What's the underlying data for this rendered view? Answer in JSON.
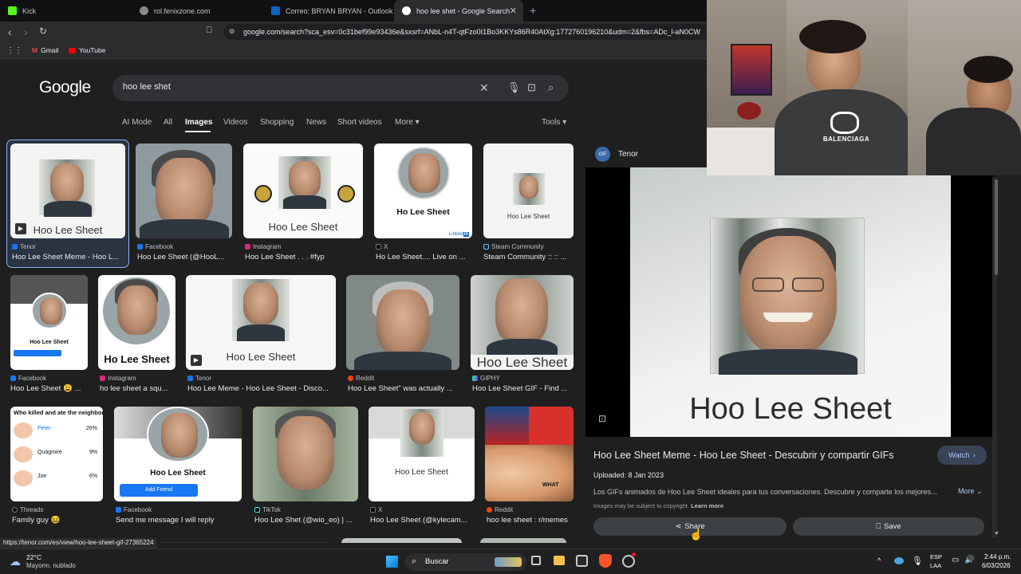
{
  "browser": {
    "tabs": [
      {
        "title": "Kick",
        "favicon_color": "#53fc18"
      },
      {
        "title": "rol.fenixzone.com",
        "favicon_color": "#888888"
      },
      {
        "title": "Correo: BRYAN BRYAN - Outlook",
        "favicon_color": "#0a64c8"
      },
      {
        "title": "hoo lee shet - Google Search",
        "favicon_color": "#ffffff"
      }
    ],
    "new_tab": "+",
    "close_tab": "✕",
    "url": "google.com/search?sca_esv=0c31bef99e93436e&sxsrf=ANbL-n4T-qtFzo0I1Bo3KKYs86R40AtXg:1772760196210&udm=2&fbs=ADc_l-aN0CW",
    "bookmarks": [
      "Gmail",
      "YouTube"
    ]
  },
  "search": {
    "logo": "Google",
    "query": "hoo lee shet",
    "tabs": [
      "AI Mode",
      "All",
      "Images",
      "Videos",
      "Shopping",
      "News",
      "Short videos",
      "More",
      "Tools"
    ],
    "selected_tab": "Images"
  },
  "results": [
    {
      "source": "Tenor",
      "title": "Hoo Lee Sheet Meme - Hoo L...",
      "caption": "Hoo Lee Sheet"
    },
    {
      "source": "Facebook",
      "title": "Hoo Lee Sheet (@HooL...",
      "caption": ""
    },
    {
      "source": "Instagram",
      "title": "Hoo Lee Sheet . . . #fyp",
      "caption": "Hoo Lee Sheet"
    },
    {
      "source": "X",
      "title": "Ho Lee Sheet.... Live on ...",
      "caption": "Ho Lee Sheet"
    },
    {
      "source": "Steam Community",
      "title": "Steam Community :: :: ...",
      "caption": "Hoo Lee Sheet"
    },
    {
      "source": "Facebook",
      "title": "Hoo Lee Sheet 😩 ...",
      "caption": "Hoo Lee Sheet"
    },
    {
      "source": "Instagram",
      "title": "ho lee sheet a squ...",
      "caption": "Ho Lee Sheet"
    },
    {
      "source": "Tenor",
      "title": "Hoo Lee Meme - Hoo Lee Sheet - Disco...",
      "caption": "Hoo Lee Sheet"
    },
    {
      "source": "Reddit",
      "title": "Hoo Lee Sheet\" was actually ...",
      "caption": ""
    },
    {
      "source": "GIPHY",
      "title": "Hoo Lee Sheet GIF - Find ...",
      "caption": "Hoo Lee Sheet"
    },
    {
      "source": "Threads",
      "title": "Family guy 😆",
      "caption": "Who killed and ate the neighbors cat"
    },
    {
      "source": "Facebook",
      "title": "Send me message I will reply",
      "caption": "Hoo Lee Sheet"
    },
    {
      "source": "TikTok",
      "title": "Hoo Lee Shet (@wio_eo) | ...",
      "caption": ""
    },
    {
      "source": "X",
      "title": "Hoo Lee Sheet (@kylecam...",
      "caption": "Hoo Lee Sheet"
    },
    {
      "source": "Reddit",
      "title": "hoo lee sheet : r/memes",
      "caption": "WHAT"
    }
  ],
  "poll": {
    "rows": [
      {
        "name": "Peter",
        "pct": "26%"
      },
      {
        "name": "Quagmire",
        "pct": "9%"
      },
      {
        "name": "Joe",
        "pct": "6%"
      }
    ],
    "button": "Add Friend"
  },
  "panel": {
    "source": "Tenor",
    "source_badge": "GIF",
    "image_caption": "Hoo Lee Sheet",
    "title": "Hoo Lee Sheet Meme - Hoo Lee Sheet - Descubrir y compartir GIFs",
    "watch": "Watch",
    "uploaded": "Uploaded: 8 Jan 2023",
    "description": "Los GIFs animados de Hoo Lee Sheet ideales para tus conversaciones. Descubre y comparte los mejores...",
    "more": "More",
    "copyright": "Images may be subject to copyright.",
    "learn_more": "Learn more",
    "share": "Share",
    "save": "Save"
  },
  "status_url": "https://tenor.com/es/view/hoo-lee-sheet-gif-27365224",
  "webcam": {
    "shirt_text": "BALENCIAGA"
  },
  "taskbar": {
    "weather_temp": "22°C",
    "weather_desc": "Mayorm. nublado",
    "search": "Buscar",
    "lang": "ESP",
    "lang2": "LAA",
    "time": "2:44 p.m.",
    "date": "6/03/2026"
  }
}
